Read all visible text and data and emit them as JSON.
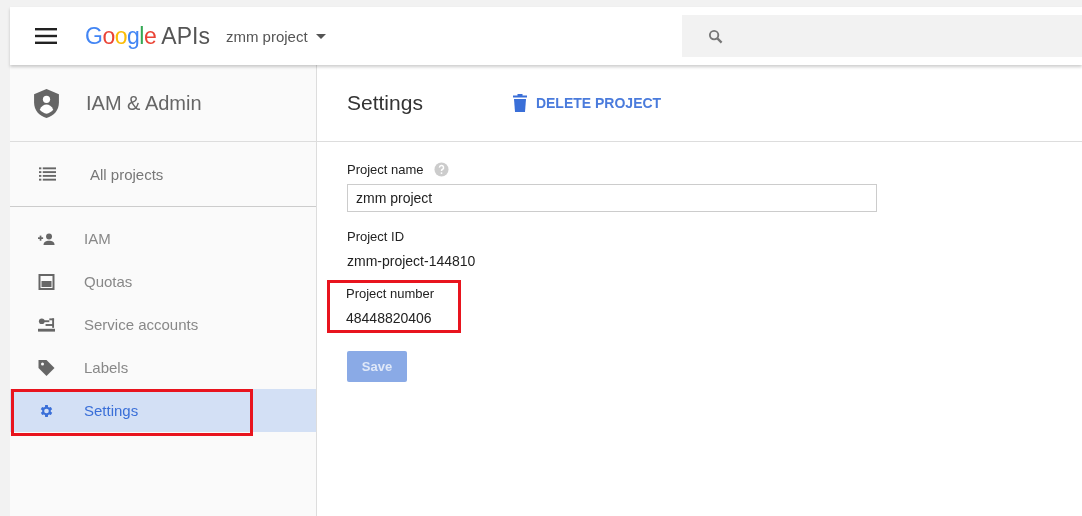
{
  "header": {
    "logo_word": "Google",
    "logo_suffix": "APIs",
    "project": "zmm project"
  },
  "sidebar": {
    "title": "IAM & Admin",
    "top_item": {
      "label": "All projects"
    },
    "items": [
      {
        "label": "IAM",
        "kind": "person-add",
        "selected": false,
        "highlighted": false
      },
      {
        "label": "Quotas",
        "kind": "quota",
        "selected": false,
        "highlighted": false
      },
      {
        "label": "Service accounts",
        "kind": "service",
        "selected": false,
        "highlighted": false
      },
      {
        "label": "Labels",
        "kind": "tag",
        "selected": false,
        "highlighted": false
      },
      {
        "label": "Settings",
        "kind": "gear",
        "selected": true,
        "highlighted": true
      }
    ]
  },
  "content": {
    "title": "Settings",
    "delete_label": "DELETE PROJECT",
    "name_label": "Project name",
    "name_value": "zmm project",
    "fields": [
      {
        "label": "Project ID",
        "value": "zmm-project-144810",
        "highlighted": false
      },
      {
        "label": "Project number",
        "value": "48448820406",
        "highlighted": true
      }
    ],
    "save": {
      "label": "Save",
      "disabled": true
    }
  }
}
